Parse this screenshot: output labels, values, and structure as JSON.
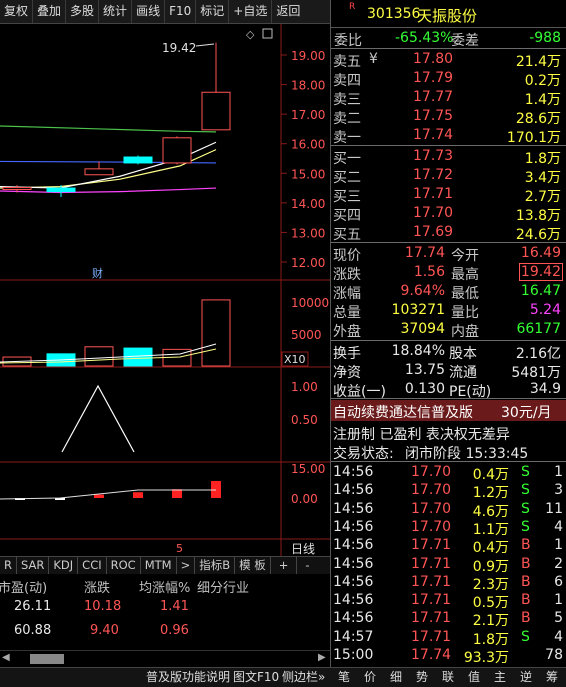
{
  "toolbar": {
    "items": [
      "复权",
      "叠加",
      "多股",
      "统计",
      "画线",
      "F10",
      "标记",
      "+自选",
      "返回"
    ]
  },
  "chart": {
    "price_axis": [
      "19.00",
      "18.00",
      "17.00",
      "16.00",
      "15.00",
      "14.00",
      "13.00",
      "12.00"
    ],
    "high_label": "19.42",
    "fin_label": "财",
    "volume_axis": [
      "10000",
      "5000"
    ],
    "volume_unit": "X10",
    "kdj_axis": [
      "1.00",
      "0.50"
    ],
    "macd_axis": [
      "15.00",
      "0.00"
    ],
    "bottom_tick": "5",
    "bottom_right_label": "日线"
  },
  "chart_data": {
    "type": "candlestick",
    "ylim": [
      11.6,
      19.9
    ],
    "candles": [
      {
        "open": 14.48,
        "close": 14.52,
        "high": 14.6,
        "low": 14.35,
        "color": "red"
      },
      {
        "open": 14.5,
        "close": 14.38,
        "high": 14.6,
        "low": 14.2,
        "color": "cyan"
      },
      {
        "open": 14.95,
        "close": 15.15,
        "high": 15.4,
        "low": 14.95,
        "color": "red"
      },
      {
        "open": 15.55,
        "close": 15.35,
        "high": 15.6,
        "low": 15.3,
        "color": "cyan"
      },
      {
        "open": 15.35,
        "close": 16.2,
        "high": 16.25,
        "low": 15.3,
        "color": "red"
      },
      {
        "open": 16.47,
        "close": 17.74,
        "high": 19.42,
        "low": 16.47,
        "color": "red"
      }
    ],
    "volume": [
      1400,
      1900,
      3000,
      2800,
      2600,
      10327
    ],
    "kdj": [
      {
        "x": 0,
        "y": 0.0
      },
      {
        "x": 1,
        "y": 1.0
      },
      {
        "x": 2,
        "y": 0.0
      }
    ],
    "macd": [
      -0.9,
      -0.3,
      1.7,
      2.9,
      4.4,
      8.5
    ]
  },
  "ind_tabs": [
    "R",
    "SAR",
    "KDJ",
    "CCI",
    "ROC",
    "MTM",
    ">",
    "指标B",
    "模 板",
    "+",
    "-"
  ],
  "lower": {
    "headers": [
      "市盈(动)",
      "涨跌",
      "均涨幅%",
      "细分行业"
    ],
    "rows": [
      [
        "26.11",
        "10.18",
        "1.41"
      ],
      [
        "60.88",
        "9.40",
        "0.96"
      ]
    ]
  },
  "bottom_bar": {
    "items": [
      "普及版功能说明",
      "图文F10",
      "侧边栏»"
    ],
    "tabs": [
      "笔",
      "价",
      "细",
      "势",
      "联",
      "值",
      "主",
      "逆",
      "筹"
    ]
  },
  "stock": {
    "flag": "R",
    "code": "301356",
    "name": "天振股份"
  },
  "commission": {
    "ratio_label": "委比",
    "ratio": "-65.43%",
    "diff_label": "委差",
    "diff": "-988"
  },
  "asks": [
    {
      "label": "卖五",
      "marker": "¥",
      "price": "17.80",
      "vol": "21.4万"
    },
    {
      "label": "卖四",
      "marker": "",
      "price": "17.79",
      "vol": "0.2万"
    },
    {
      "label": "卖三",
      "marker": "",
      "price": "17.77",
      "vol": "1.4万"
    },
    {
      "label": "卖二",
      "marker": "",
      "price": "17.75",
      "vol": "28.6万"
    },
    {
      "label": "卖一",
      "marker": "",
      "price": "17.74",
      "vol": "170.1万"
    }
  ],
  "bids": [
    {
      "label": "买一",
      "price": "17.73",
      "vol": "1.8万"
    },
    {
      "label": "买二",
      "price": "17.72",
      "vol": "3.4万"
    },
    {
      "label": "买三",
      "price": "17.71",
      "vol": "2.7万"
    },
    {
      "label": "买四",
      "price": "17.70",
      "vol": "13.8万"
    },
    {
      "label": "买五",
      "price": "17.69",
      "vol": "24.6万"
    }
  ],
  "quote": [
    {
      "l1": "现价",
      "v1": "17.74",
      "l2": "今开",
      "v2": "16.49"
    },
    {
      "l1": "涨跌",
      "v1": "1.56",
      "l2": "最高",
      "v2": "19.42"
    },
    {
      "l1": "涨幅",
      "v1": "9.64%",
      "l2": "最低",
      "v2": "16.47"
    },
    {
      "l1": "总量",
      "v1": "103271",
      "l2": "量比",
      "v2": "5.24"
    },
    {
      "l1": "外盘",
      "v1": "37094",
      "l2": "内盘",
      "v2": "66177"
    }
  ],
  "fundamentals": [
    {
      "l1": "换手",
      "v1": "18.84%",
      "l2": "股本",
      "v2": "2.16亿"
    },
    {
      "l1": "净资",
      "v1": "13.75",
      "l2": "流通",
      "v2": "5481万"
    },
    {
      "l1": "收益(一)",
      "v1": "0.130",
      "l2": "PE(动)",
      "v2": "34.9"
    }
  ],
  "ad": {
    "text": "自动续费通达信普及版",
    "price": "30元/月"
  },
  "notice": "注册制 已盈利 表决权无差异",
  "trade_state": {
    "label": "交易状态:",
    "value": "闭市阶段 15:33:45"
  },
  "ticks": [
    {
      "time": "14:56",
      "price": "17.70",
      "vol": "0.4万",
      "side": "S",
      "count": "1"
    },
    {
      "time": "14:56",
      "price": "17.70",
      "vol": "1.2万",
      "side": "S",
      "count": "3"
    },
    {
      "time": "14:56",
      "price": "17.70",
      "vol": "4.6万",
      "side": "S",
      "count": "11"
    },
    {
      "time": "14:56",
      "price": "17.70",
      "vol": "1.1万",
      "side": "S",
      "count": "4"
    },
    {
      "time": "14:56",
      "price": "17.71",
      "vol": "0.4万",
      "side": "B",
      "count": "1"
    },
    {
      "time": "14:56",
      "price": "17.71",
      "vol": "0.9万",
      "side": "B",
      "count": "2"
    },
    {
      "time": "14:56",
      "price": "17.71",
      "vol": "2.3万",
      "side": "B",
      "count": "6"
    },
    {
      "time": "14:56",
      "price": "17.71",
      "vol": "0.5万",
      "side": "B",
      "count": "1"
    },
    {
      "time": "14:56",
      "price": "17.71",
      "vol": "2.1万",
      "side": "B",
      "count": "5"
    },
    {
      "time": "14:57",
      "price": "17.71",
      "vol": "1.8万",
      "side": "S",
      "count": "4"
    },
    {
      "time": "15:00",
      "price": "17.74",
      "vol": "93.3万",
      "side": "",
      "count": "78"
    }
  ]
}
